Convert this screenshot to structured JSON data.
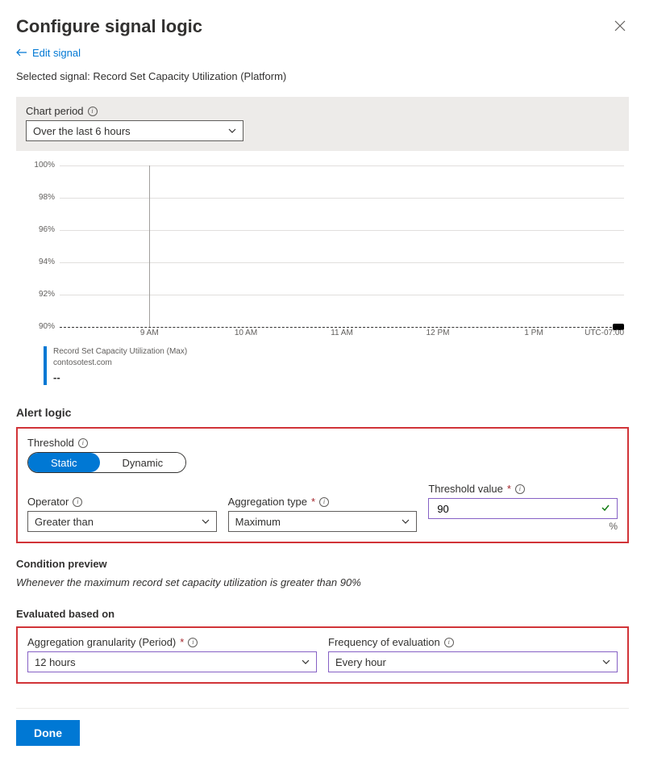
{
  "header": {
    "title": "Configure signal logic",
    "edit_link": "Edit signal",
    "selected_signal_label": "Selected signal:",
    "selected_signal_value": "Record Set Capacity Utilization (Platform)"
  },
  "chart_period": {
    "label": "Chart period",
    "value": "Over the last 6 hours"
  },
  "chart_data": {
    "type": "line",
    "title": "",
    "ylabel": "",
    "xlabel": "",
    "ylim": [
      90,
      100
    ],
    "y_ticks": [
      90,
      92,
      94,
      96,
      98,
      100
    ],
    "y_tick_labels": [
      "90%",
      "92%",
      "94%",
      "96%",
      "98%",
      "100%"
    ],
    "x_tick_labels": [
      "9 AM",
      "10 AM",
      "11 AM",
      "12 PM",
      "1 PM"
    ],
    "timezone": "UTC-07:00",
    "threshold_line": 90,
    "series": [
      {
        "name": "Record Set Capacity Utilization (Max)",
        "source": "contosotest.com",
        "current_value": "--"
      }
    ]
  },
  "alert_logic": {
    "section_title": "Alert logic",
    "threshold_label": "Threshold",
    "threshold_options": [
      "Static",
      "Dynamic"
    ],
    "threshold_selected": "Static",
    "operator_label": "Operator",
    "operator_value": "Greater than",
    "aggregation_label": "Aggregation type",
    "aggregation_value": "Maximum",
    "threshold_value_label": "Threshold value",
    "threshold_value": "90",
    "threshold_unit": "%"
  },
  "condition_preview": {
    "title": "Condition preview",
    "text": "Whenever the maximum record set capacity utilization is greater than 90%"
  },
  "evaluated": {
    "title": "Evaluated based on",
    "granularity_label": "Aggregation granularity (Period)",
    "granularity_value": "12 hours",
    "frequency_label": "Frequency of evaluation",
    "frequency_value": "Every hour"
  },
  "footer": {
    "done": "Done"
  }
}
